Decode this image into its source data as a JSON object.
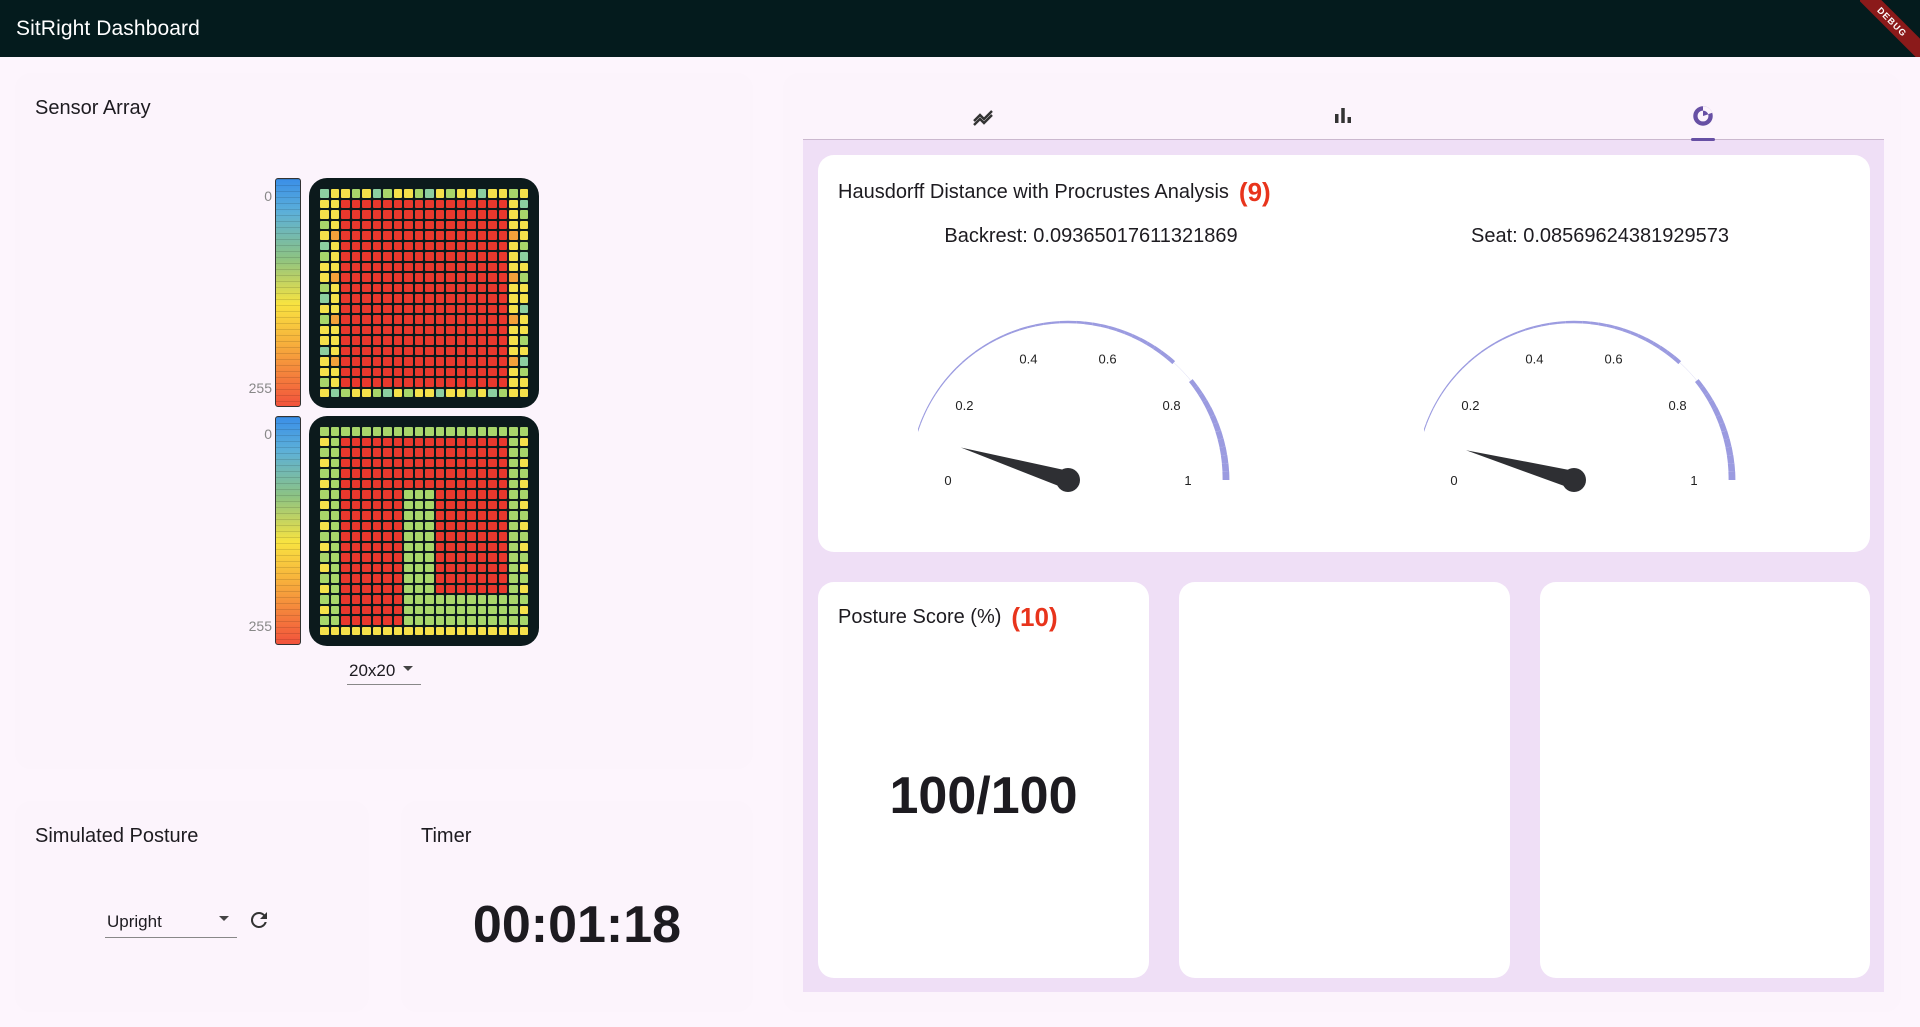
{
  "app": {
    "title": "SitRight Dashboard",
    "debug_label": "DEBUG"
  },
  "sensor_array": {
    "title": "Sensor Array",
    "scale_min": "0",
    "scale_max": "255",
    "resolution": "20x20"
  },
  "simulated_posture": {
    "title": "Simulated Posture",
    "selected": "Upright"
  },
  "timer": {
    "title": "Timer",
    "value": "00:01:18"
  },
  "tabs": [
    {
      "name": "trend-icon",
      "selected": false
    },
    {
      "name": "bar-chart-icon",
      "selected": false
    },
    {
      "name": "gauge-icon",
      "selected": true
    }
  ],
  "hausdorff": {
    "title": "Hausdorff Distance with Procrustes Analysis",
    "annotation": "(9)",
    "backrest_label": "Backrest: 0.09365017611321869",
    "seat_label": "Seat: 0.08569624381929573",
    "backrest_value": 0.09365017611321869,
    "seat_value": 0.08569624381929573,
    "ticks": [
      "0",
      "0.2",
      "0.4",
      "0.6",
      "0.8",
      "1"
    ],
    "gauge_color": "#9b9be0"
  },
  "posture_score": {
    "title": "Posture Score (%)",
    "annotation": "(10)",
    "value": "100/100"
  }
}
